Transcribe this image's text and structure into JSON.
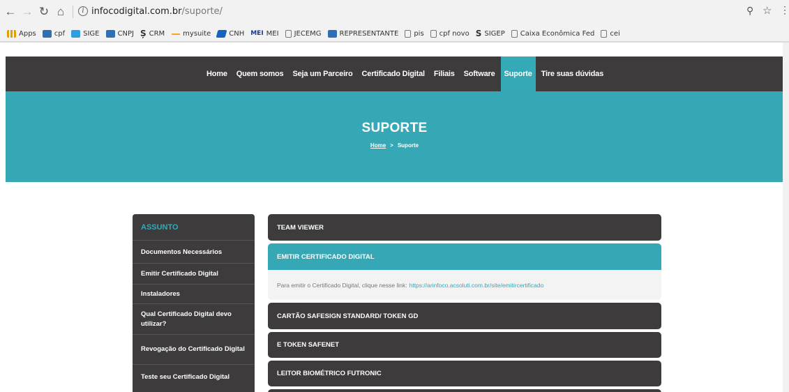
{
  "browser": {
    "url_host": "infocodigital.com.br",
    "url_path": "/suporte/",
    "bookmarks": [
      {
        "label": "Apps",
        "icon": "apps-grid-icon"
      },
      {
        "label": "cpf",
        "icon": "receita-icon"
      },
      {
        "label": "SIGE",
        "icon": "cloud-icon"
      },
      {
        "label": "CNPJ",
        "icon": "receita-icon"
      },
      {
        "label": "CRM",
        "icon": "s-logo-icon"
      },
      {
        "label": "mysuite",
        "icon": "dash-icon"
      },
      {
        "label": "CNH",
        "icon": "cnh-icon"
      },
      {
        "label": "MEI",
        "icon": "mei-icon"
      },
      {
        "label": "JECEMG",
        "icon": "doc-icon"
      },
      {
        "label": "REPRESENTANTE",
        "icon": "receita-icon"
      },
      {
        "label": "pis",
        "icon": "doc-icon"
      },
      {
        "label": "cpf novo",
        "icon": "doc-icon"
      },
      {
        "label": "SIGEP",
        "icon": "s-logo-icon"
      },
      {
        "label": "Caixa Econômica Fed",
        "icon": "doc-icon"
      },
      {
        "label": "cei",
        "icon": "doc-icon"
      }
    ],
    "mei_badge": "MEI"
  },
  "nav": {
    "items": [
      {
        "label": "Home"
      },
      {
        "label": "Quem somos"
      },
      {
        "label": "Seja um Parceiro"
      },
      {
        "label": "Certificado Digital"
      },
      {
        "label": "Filiais"
      },
      {
        "label": "Software"
      },
      {
        "label": "Suporte"
      },
      {
        "label": "Tire suas dúvidas"
      }
    ],
    "active": "Suporte"
  },
  "hero": {
    "title": "SUPORTE",
    "breadcrumb_home": "Home",
    "breadcrumb_sep": ">",
    "breadcrumb_current": "Suporte"
  },
  "sidebar": {
    "heading": "ASSUNTO",
    "items": [
      {
        "label": "Documentos Necessários"
      },
      {
        "label": "Emitir Certificado Digital"
      },
      {
        "label": "Instaladores"
      },
      {
        "label": "Qual Certificado Digital devo utilizar?"
      },
      {
        "label": "Revogação do Certificado Digital"
      },
      {
        "label": "Teste seu Certificado Digital"
      }
    ]
  },
  "accordion": {
    "items": [
      {
        "title": "TEAM VIEWER"
      },
      {
        "title": "EMITIR CERTIFICADO DIGITAL"
      },
      {
        "title": "CARTÃO SAFESIGN STANDARD/ TOKEN GD"
      },
      {
        "title": "E TOKEN SAFENET"
      },
      {
        "title": "LEITOR BIOMÉTRICO FUTRONIC"
      }
    ],
    "open_text": "Para emitir o Certificado Digital, clique nesse link:",
    "open_link": "https://arinfoco.acsoluti.com.br/site/emitircertificado"
  },
  "colors": {
    "dark": "#3d3b3c",
    "teal": "#36a8b5"
  }
}
